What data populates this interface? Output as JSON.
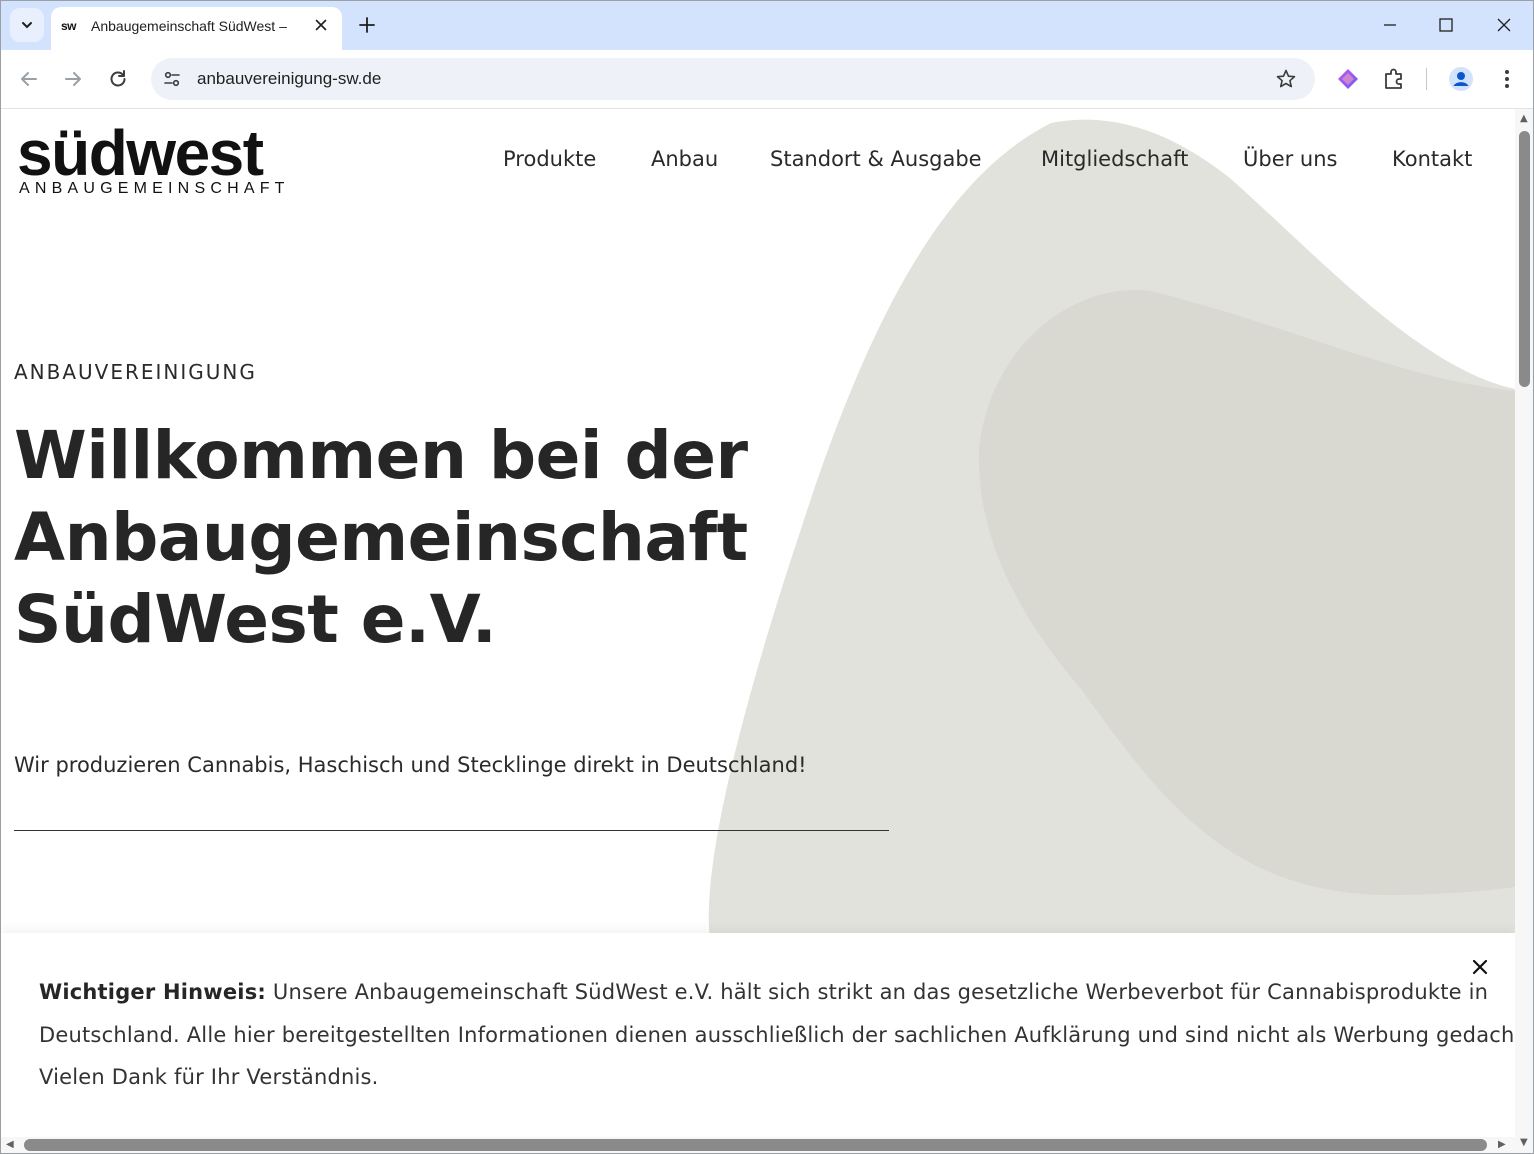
{
  "browser": {
    "tab": {
      "favicon_text": "sw",
      "title": "Anbaugemeinschaft SüdWest –"
    },
    "address_bar": {
      "url": "anbauvereinigung-sw.de"
    }
  },
  "site": {
    "logo": {
      "main": "südwest",
      "sub": "ANBAUGEMEINSCHAFT"
    },
    "nav": {
      "items": [
        "Produkte",
        "Anbau",
        "Standort & Ausgabe",
        "Mitgliedschaft",
        "Über uns",
        "Kontakt"
      ]
    },
    "hero": {
      "eyebrow": "ANBAUVEREINIGUNG",
      "headline_lines": [
        "Willkommen bei der",
        "Anbaugemeinschaft",
        "SüdWest e.V."
      ],
      "subtext": "Wir produzieren Cannabis, Haschisch und Stecklinge direkt in Deutschland!"
    },
    "notice": {
      "label": "Wichtiger Hinweis:",
      "text": " Unsere Anbaugemeinschaft SüdWest e.V. hält sich strikt an das gesetzliche Werbeverbot für Cannabisprodukte in Deutschland. Alle hier bereitgestellten Informationen dienen ausschließlich der sachlichen Aufklärung und sind nicht als Werbung gedacht. Vielen Dank für Ihr Verständnis."
    }
  },
  "colors": {
    "titlebar": "#d3e3fd",
    "blob_outer": "#e2e2dc",
    "blob_inner": "#d9d8d1",
    "text": "#262626"
  },
  "icons": [
    "tab-search-icon",
    "close-icon",
    "plus-icon",
    "minimize-icon",
    "maximize-icon",
    "back-icon",
    "forward-icon",
    "reload-icon",
    "site-info-icon",
    "star-icon",
    "gemini-icon",
    "extensions-icon",
    "profile-icon",
    "menu-icon"
  ]
}
